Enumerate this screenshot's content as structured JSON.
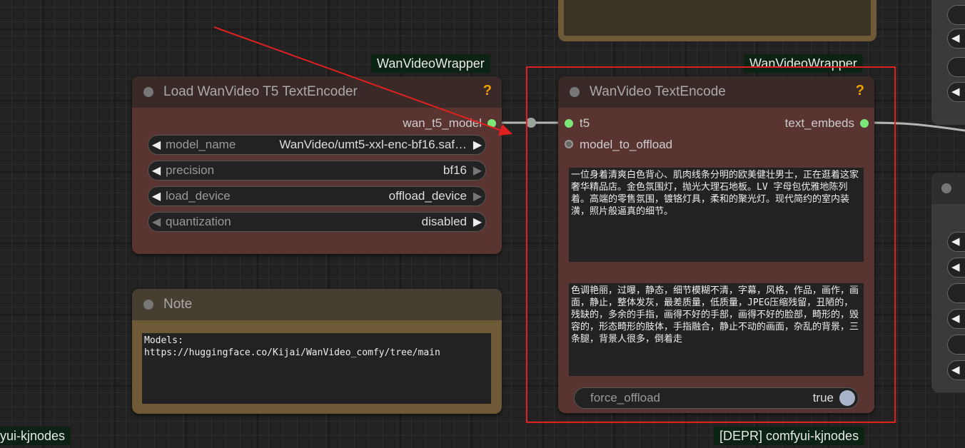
{
  "groups": {
    "top_left": "WanVideoWrapper",
    "top_right": "WanVideoWrapper",
    "bottom_left": "yui-kjnodes",
    "bottom_right": "[DEPR] comfyui-kjnodes"
  },
  "load_node": {
    "title": "Load WanVideo T5 TextEncoder",
    "help": "?",
    "output_label": "wan_t5_model",
    "widgets": [
      {
        "label": "model_name",
        "value": "WanVideo/umt5-xxl-enc-bf16.saf…"
      },
      {
        "label": "precision",
        "value": "bf16"
      },
      {
        "label": "load_device",
        "value": "offload_device"
      },
      {
        "label": "quantization",
        "value": "disabled"
      }
    ]
  },
  "note_node": {
    "title": "Note",
    "text": "Models:\nhttps://huggingface.co/Kijai/WanVideo_comfy/tree/main"
  },
  "encode_node": {
    "title": "WanVideo TextEncode",
    "help": "?",
    "input_t5": "t5",
    "input_offload": "model_to_offload",
    "output_label": "text_embeds",
    "positive_prompt": "一位身着清爽白色背心、肌肉线条分明的欧美健壮男士，正在逛着这家奢华精品店。金色氛围灯，抛光大理石地板。LV 字母包优雅地陈列着。高端的零售氛围，镀铬灯具，柔和的聚光灯。现代简约的室内装潢，照片般逼真的细节。",
    "negative_prompt": "色调艳丽，过曝，静态，细节模糊不清，字幕，风格，作品，画作，画面，静止，整体发灰，最差质量，低质量，JPEG压缩残留，丑陋的，残缺的，多余的手指，画得不好的手部，画得不好的脸部，畸形的，毁容的，形态畸形的肢体，手指融合，静止不动的画面，杂乱的背景，三条腿，背景人很多，倒着走",
    "toggle_label": "force_offload",
    "toggle_value": "true"
  },
  "right_pills": [
    "◀",
    "◀",
    "◀",
    "◀",
    "◀",
    "◀"
  ],
  "colors": {
    "node_body": "#5a3431",
    "highlight": "#e02020",
    "connector": "#79e879",
    "arrow": "#e02020"
  }
}
